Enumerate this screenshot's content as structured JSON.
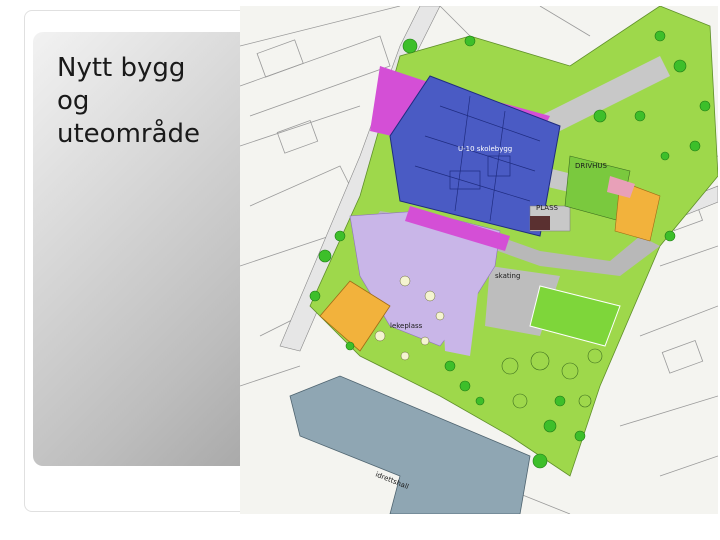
{
  "slide": {
    "title": "Nytt bygg\nog\nuteområde"
  },
  "plan": {
    "labels": {
      "building": "U-10 skolebygg",
      "plaza": "PLASS",
      "greenhouse": "DRIVHUS",
      "skating": "skating",
      "lekeplass": "lekeplass",
      "sports_hall": "idrettshall"
    },
    "colors": {
      "grass": "#9ed84b",
      "building": "#4a5bc4",
      "roof_magenta": "#d44fd6",
      "courtyard_lilac": "#c9b6e8",
      "paving_grey": "#b8b8b8",
      "court_orange": "#f2b23c",
      "sports_hall_steel": "#8fa6b3",
      "tree_green": "#3dbf2a"
    }
  }
}
